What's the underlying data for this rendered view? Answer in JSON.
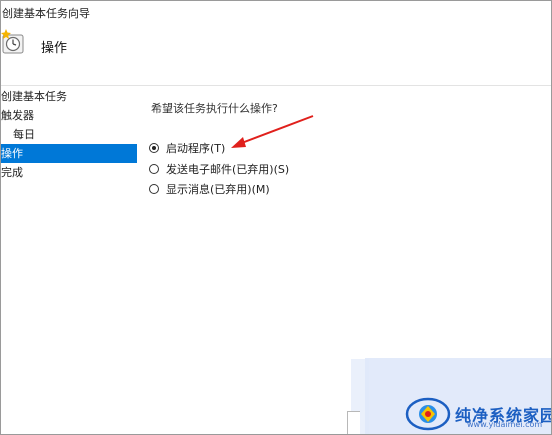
{
  "window": {
    "title": "创建基本任务向导"
  },
  "header": {
    "title": "操作",
    "icon": "task-clock-star-icon"
  },
  "nav": {
    "items": [
      {
        "label": "创建基本任务",
        "indent": false,
        "active": false
      },
      {
        "label": "触发器",
        "indent": false,
        "active": false
      },
      {
        "label": "每日",
        "indent": true,
        "active": false
      },
      {
        "label": "操作",
        "indent": false,
        "active": true
      },
      {
        "label": "完成",
        "indent": false,
        "active": false
      }
    ]
  },
  "main": {
    "question": "希望该任务执行什么操作?",
    "options": [
      {
        "label": "启动程序(T)",
        "checked": true
      },
      {
        "label": "发送电子邮件(已弃用)(S)",
        "checked": false
      },
      {
        "label": "显示消息(已弃用)(M)",
        "checked": false
      }
    ]
  },
  "annotation": {
    "arrow_color": "#e0201c"
  },
  "watermark": {
    "text": "纯净系统家园",
    "url": "www.yidaimei.com"
  },
  "colors": {
    "accent": "#0078d7"
  }
}
